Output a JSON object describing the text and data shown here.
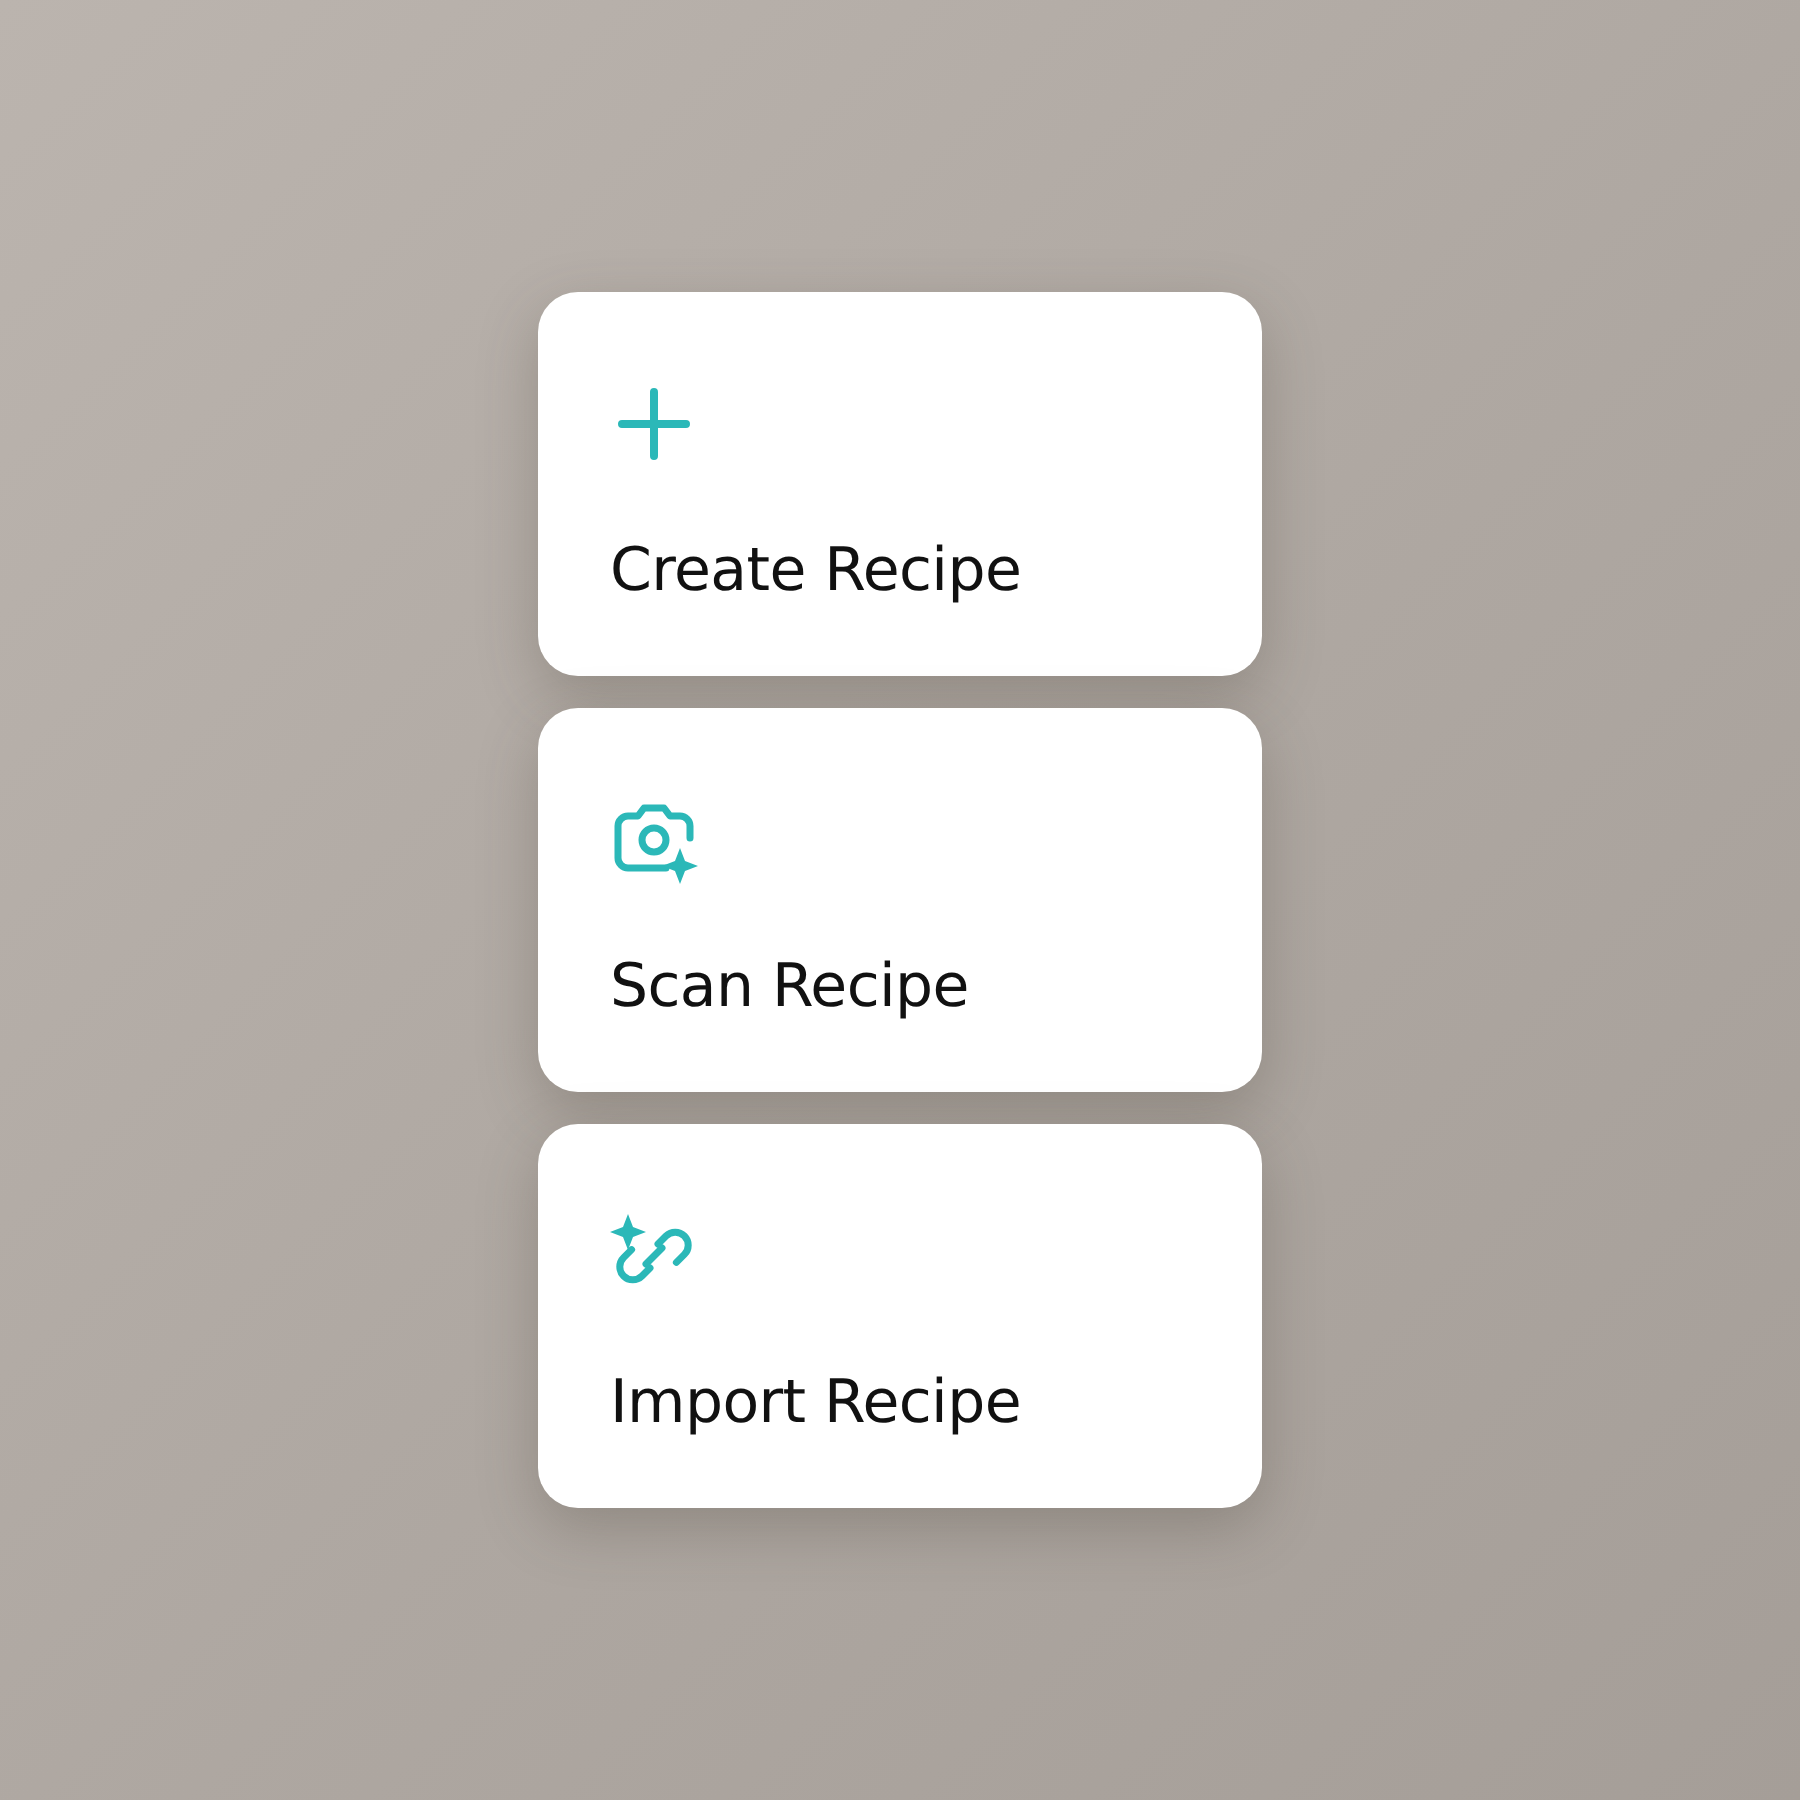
{
  "actions": [
    {
      "kind": "create",
      "label": "Create Recipe"
    },
    {
      "kind": "scan",
      "label": "Scan Recipe"
    },
    {
      "kind": "import",
      "label": "Import Recipe"
    }
  ]
}
